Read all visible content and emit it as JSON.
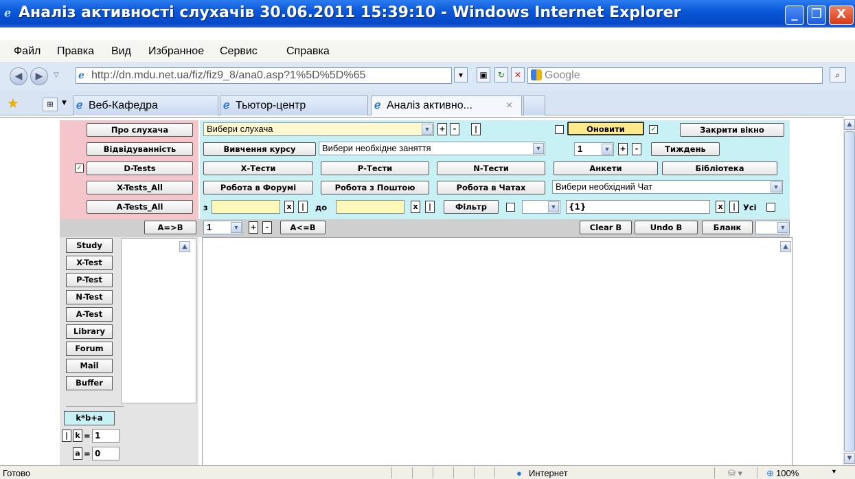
{
  "window": {
    "title": "Аналіз активності слухачів 30.06.2011 15:39:10 - Windows Internet Explorer",
    "min": "_",
    "max": "❐",
    "close": "X"
  },
  "menu": [
    "Файл",
    "Правка",
    "Вид",
    "Избранное",
    "Сервис",
    "Справка"
  ],
  "address": {
    "url": "http://dn.mdu.net.ua/fiz/fiz9_8/ana0.asp?1%5D%5D%65",
    "search_placeholder": "Google"
  },
  "tabs": [
    "Веб-Кафедра",
    "Тьютор-центр",
    "Аналіз активно..."
  ],
  "tab_close": "×",
  "left": {
    "buttons": [
      "Про слухача",
      "Відвідуванність",
      "D-Tests",
      "X-Tests_All",
      "A-Tests_All"
    ],
    "dtests_checked": "✓",
    "aeb": "A=>B"
  },
  "row1": {
    "student_select": "Вибери слухача",
    "plus": "+",
    "minus": "-",
    "bar": "|",
    "refresh": "Оновити",
    "close_window": "Закрити вікно",
    "checked": "✓"
  },
  "row2": {
    "study": "Вивчення курсу",
    "lesson_select": "Вибери необхідне заняття",
    "week_num": "1",
    "week": "Тиждень"
  },
  "row3": [
    "Х-Тести",
    "Р-Тести",
    "N-Тести",
    "Анкети",
    "Бібліотека"
  ],
  "row4": {
    "forum": "Робота в Форумі",
    "mail": "Робота з Поштою",
    "chat": "Робота в Чатах",
    "chat_select": "Вибери необхідний Чат"
  },
  "row5": {
    "from": "з",
    "to": "до",
    "x": "x",
    "filter": "Фільтр",
    "value": "{1}",
    "all": "Усі"
  },
  "row6": {
    "num": "1",
    "abe": "A<=B",
    "clear": "Clear B",
    "undo": "Undo B",
    "blank": "Бланк"
  },
  "sidebar": {
    "buttons": [
      "Study",
      "X-Test",
      "P-Test",
      "N-Test",
      "A-Test",
      "Library",
      "Forum",
      "Mail",
      "Buffer"
    ],
    "kba": "k*b+a",
    "k_label": "k",
    "k_value": "1",
    "a_label": "a",
    "a_value": "0",
    "eq": "="
  },
  "status": {
    "ready": "Готово",
    "zone": "Интернет",
    "zoom": "100%"
  },
  "colors": {
    "pink": "#f4c6cc",
    "cyan": "#c7f1f4",
    "grey": "#cfcfcf",
    "yellow_button": "#ffe98a",
    "titlebar": "#0548c8"
  }
}
